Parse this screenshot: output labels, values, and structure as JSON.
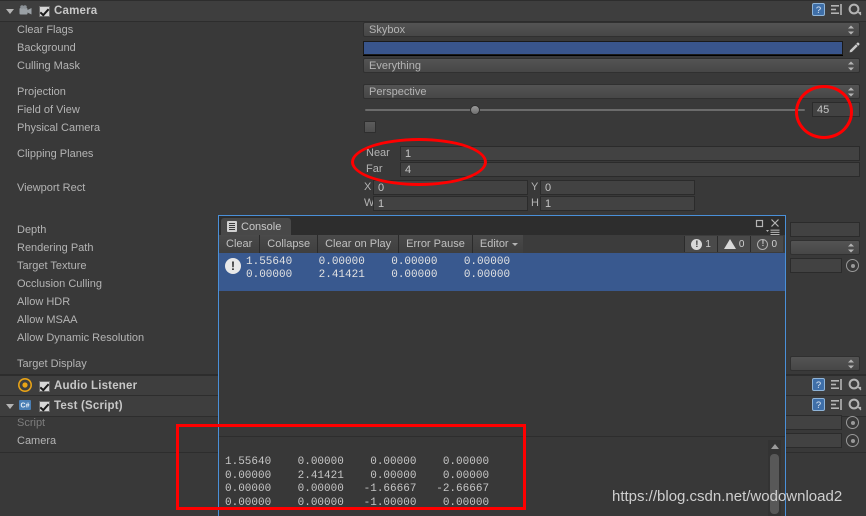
{
  "inspector": {
    "camera_component": {
      "title": "Camera",
      "icon": "camera-icon",
      "enabled_checkbox": "checked",
      "header_icons": [
        "help-icon",
        "preset-icon",
        "settings-gear-icon"
      ]
    },
    "fields": [
      {
        "label": "Clear Flags",
        "type": "dropdown",
        "value": "Skybox"
      },
      {
        "label": "Background",
        "type": "color",
        "value": "#39558c"
      },
      {
        "label": "Culling Mask",
        "type": "dropdown",
        "value": "Everything"
      },
      {
        "label": "Projection",
        "type": "dropdown",
        "value": "Perspective"
      },
      {
        "label": "Field of View",
        "type": "slider",
        "value": "45"
      },
      {
        "label": "Physical Camera",
        "type": "checkbox",
        "value": "unchecked"
      }
    ],
    "clipping_planes": {
      "label": "Clipping Planes",
      "near_label": "Near",
      "near_value": "1",
      "far_label": "Far",
      "far_value": "4"
    },
    "viewport_rect": {
      "label": "Viewport Rect",
      "x_label": "X",
      "x_value": "0",
      "y_label": "Y",
      "y_value": "0",
      "w_label": "W",
      "w_value": "1",
      "h_label": "H",
      "h_value": "1"
    },
    "lower_labels": [
      "Depth",
      "Rendering Path",
      "Target Texture",
      "Occlusion Culling",
      "Allow HDR",
      "Allow MSAA",
      "Allow Dynamic Resolution",
      "Target Display"
    ],
    "audio_listener": {
      "title": "Audio Listener",
      "icon": "audio-listener-icon",
      "enabled_checkbox": "checked"
    },
    "test_script": {
      "title": "Test (Script)",
      "icon": "csharp-script-icon",
      "enabled_checkbox": "checked",
      "script_label": "Script",
      "camera_label": "Camera"
    }
  },
  "console": {
    "tab_label": "Console",
    "tab_icon": "console-doc-icon",
    "window_buttons": [
      "maximize-icon",
      "close-icon",
      "menu-icon"
    ],
    "toolbar": {
      "clear": "Clear",
      "collapse": "Collapse",
      "clear_on_play": "Clear on Play",
      "error_pause": "Error Pause",
      "editor": "Editor"
    },
    "counters": {
      "errors": "1",
      "warnings": "0",
      "infos": "0"
    },
    "log_entry": {
      "icon": "error-icon",
      "line1": "1.55640    0.00000    0.00000    0.00000",
      "line2": "0.00000    2.41421    0.00000    0.00000"
    },
    "detail": {
      "line1": "1.55640    0.00000    0.00000    0.00000",
      "line2": "0.00000    2.41421    0.00000    0.00000",
      "line3": "0.00000    0.00000   -1.66667   -2.66667",
      "line4": "0.00000    0.00000   -1.00000    0.00000"
    }
  },
  "annotations": {
    "highlight_color": "#ff0000",
    "ellipse_fov": "45",
    "ellipse_clipping": "Near / Far",
    "rect_matrix": "matrix output"
  },
  "watermark": {
    "text": "https://blog.csdn.net/wodownload2"
  }
}
